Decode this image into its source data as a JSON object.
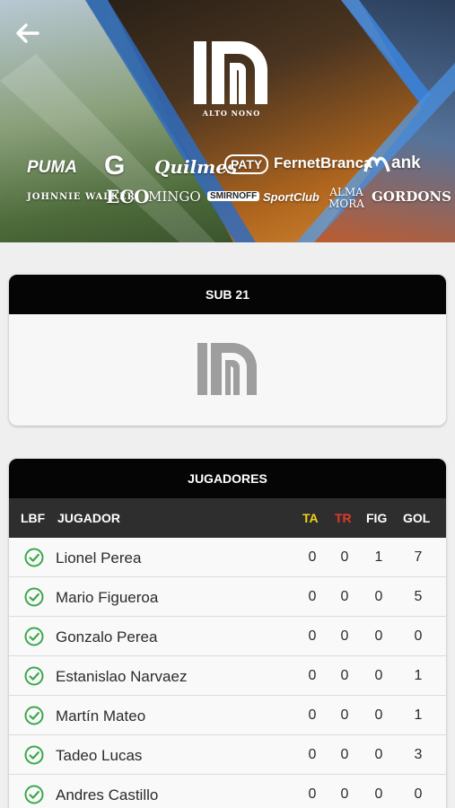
{
  "hero": {
    "logo_caption": "ALTO NONO",
    "sponsors": [
      "PUMA",
      "G",
      "Quilmes",
      "PATY",
      "FernetBranca",
      "ank",
      "JOHNNIE WALKER",
      "ECO",
      "MINGO",
      "SMIRNOFF",
      "SportClub",
      "ALMA MORA",
      "GORDONS"
    ]
  },
  "category": {
    "title": "SUB 21"
  },
  "players": {
    "title": "JUGADORES",
    "columns": {
      "lbf": "LBF",
      "name": "JUGADOR",
      "ta": "TA",
      "tr": "TR",
      "fig": "FIG",
      "gol": "GOL"
    },
    "column_colors": {
      "ta": "#f2d21b",
      "tr": "#e23a2a",
      "default": "#ffffff"
    },
    "rows": [
      {
        "name": "Lionel Perea",
        "ta": "0",
        "tr": "0",
        "fig": "1",
        "gol": "7"
      },
      {
        "name": "Mario Figueroa",
        "ta": "0",
        "tr": "0",
        "fig": "0",
        "gol": "5"
      },
      {
        "name": "Gonzalo Perea",
        "ta": "0",
        "tr": "0",
        "fig": "0",
        "gol": "0"
      },
      {
        "name": "Estanislao Narvaez",
        "ta": "0",
        "tr": "0",
        "fig": "0",
        "gol": "1"
      },
      {
        "name": "Martín Mateo",
        "ta": "0",
        "tr": "0",
        "fig": "0",
        "gol": "1"
      },
      {
        "name": "Tadeo Lucas",
        "ta": "0",
        "tr": "0",
        "fig": "0",
        "gol": "3"
      },
      {
        "name": "Andres Castillo",
        "ta": "0",
        "tr": "0",
        "fig": "0",
        "gol": "0"
      }
    ],
    "check_color": "#3aa84a"
  }
}
